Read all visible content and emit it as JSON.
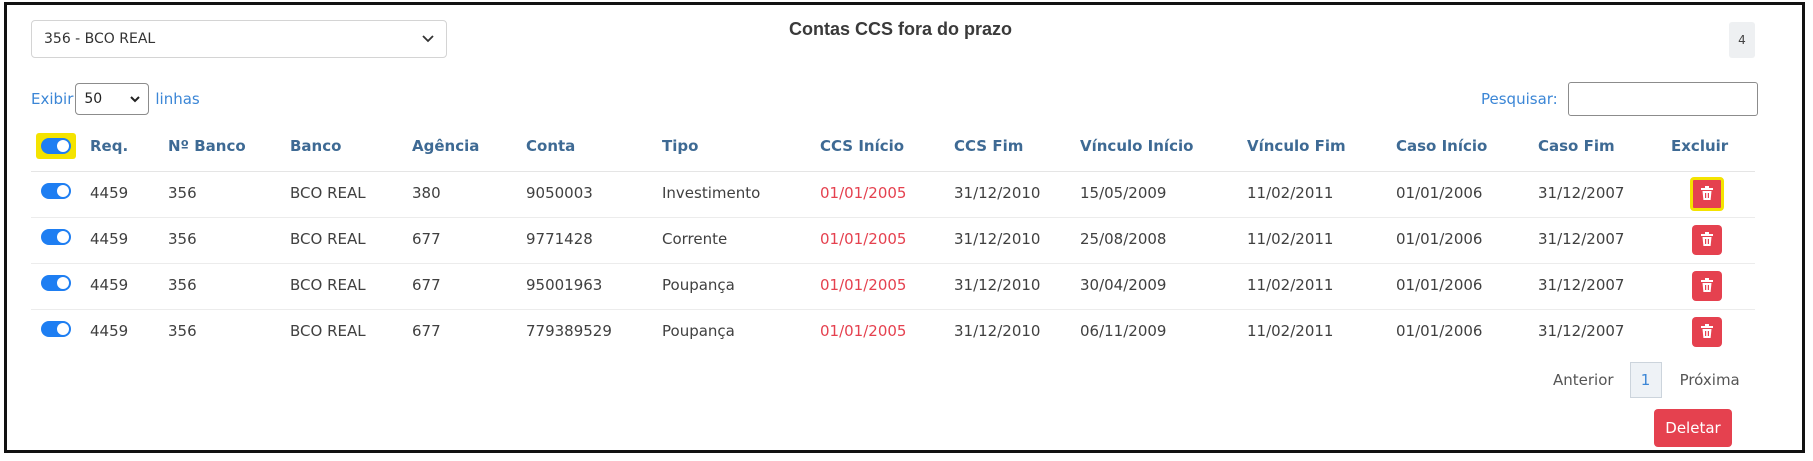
{
  "header": {
    "bank_select_value": "356 - BCO REAL",
    "title": "Contas CCS fora do prazo",
    "count": "4"
  },
  "controls": {
    "show_label": "Exibir",
    "page_length": "50",
    "lines_label": "linhas",
    "search_label": "Pesquisar:",
    "search_value": ""
  },
  "columns": [
    "Req.",
    "Nº Banco",
    "Banco",
    "Agência",
    "Conta",
    "Tipo",
    "CCS Início",
    "CCS Fim",
    "Vínculo Início",
    "Vínculo Fim",
    "Caso Início",
    "Caso Fim",
    "Excluir"
  ],
  "rows": [
    {
      "enabled": true,
      "req": "4459",
      "num_banco": "356",
      "banco": "BCO REAL",
      "agencia": "380",
      "conta": "9050003",
      "tipo": "Investimento",
      "ccs_inicio": "01/01/2005",
      "ccs_fim": "31/12/2010",
      "vinculo_inicio": "15/05/2009",
      "vinculo_fim": "11/02/2011",
      "caso_inicio": "01/01/2006",
      "caso_fim": "31/12/2007"
    },
    {
      "enabled": true,
      "req": "4459",
      "num_banco": "356",
      "banco": "BCO REAL",
      "agencia": "677",
      "conta": "9771428",
      "tipo": "Corrente",
      "ccs_inicio": "01/01/2005",
      "ccs_fim": "31/12/2010",
      "vinculo_inicio": "25/08/2008",
      "vinculo_fim": "11/02/2011",
      "caso_inicio": "01/01/2006",
      "caso_fim": "31/12/2007"
    },
    {
      "enabled": true,
      "req": "4459",
      "num_banco": "356",
      "banco": "BCO REAL",
      "agencia": "677",
      "conta": "95001963",
      "tipo": "Poupança",
      "ccs_inicio": "01/01/2005",
      "ccs_fim": "31/12/2010",
      "vinculo_inicio": "30/04/2009",
      "vinculo_fim": "11/02/2011",
      "caso_inicio": "01/01/2006",
      "caso_fim": "31/12/2007"
    },
    {
      "enabled": true,
      "req": "4459",
      "num_banco": "356",
      "banco": "BCO REAL",
      "agencia": "677",
      "conta": "779389529",
      "tipo": "Poupança",
      "ccs_inicio": "01/01/2005",
      "ccs_fim": "31/12/2010",
      "vinculo_inicio": "06/11/2009",
      "vinculo_fim": "11/02/2011",
      "caso_inicio": "01/01/2006",
      "caso_fim": "31/12/2007"
    }
  ],
  "pagination": {
    "prev_label": "Anterior",
    "current_page": "1",
    "next_label": "Próxima"
  },
  "actions": {
    "delete_label": "Deletar"
  },
  "colors": {
    "accent": "#3b86d6",
    "header_text": "#3e6a94",
    "danger": "#e5414f",
    "highlight": "#f4e300",
    "toggle_on": "#1e7ef2"
  }
}
